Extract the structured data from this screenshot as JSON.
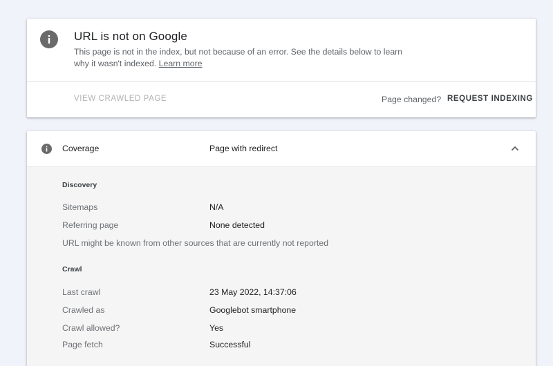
{
  "status": {
    "title": "URL is not on Google",
    "description": "This page is not in the index, but not because of an error. See the details below to learn why it wasn't indexed.",
    "learn_more": "Learn more",
    "view_crawled_label": "VIEW CRAWLED PAGE",
    "page_changed_label": "Page changed?",
    "request_indexing_label": "REQUEST INDEXING",
    "icon": "info-icon"
  },
  "coverage": {
    "label": "Coverage",
    "value": "Page with redirect",
    "icon": "info-icon",
    "toggle_icon": "chevron-up-icon",
    "discovery": {
      "title": "Discovery",
      "rows": [
        {
          "label": "Sitemaps",
          "value": "N/A"
        },
        {
          "label": "Referring page",
          "value": "None detected"
        }
      ],
      "note": "URL might be known from other sources that are currently not reported"
    },
    "crawl": {
      "title": "Crawl",
      "rows": [
        {
          "label": "Last crawl",
          "value": "23 May 2022, 14:37:06"
        },
        {
          "label": "Crawled as",
          "value": "Googlebot smartphone"
        },
        {
          "label": "Crawl allowed?",
          "value": "Yes"
        },
        {
          "label": "Page fetch",
          "value": "Successful"
        }
      ]
    }
  },
  "colors": {
    "background": "#f1f3fa",
    "icon_grey": "#6a6a6a",
    "disabled_text": "#b2b2b2"
  }
}
